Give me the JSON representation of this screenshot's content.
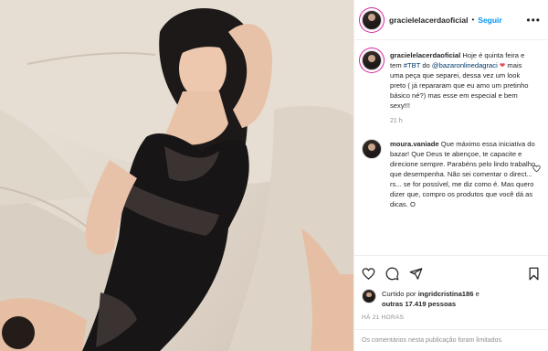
{
  "post": {
    "author": "gracielelacerdaoficial",
    "separator": "•",
    "follow_label": "Seguir",
    "more_icon": "more-horizontal-icon"
  },
  "caption": {
    "username": "gracielelacerdaoficial",
    "text_1": "Hoje é quinta feira e tem ",
    "hashtag": "#TBT",
    "text_2": " do ",
    "mention": "@bazaronlinedagraci",
    "heart": "❤",
    "text_3": " mais uma peça que separei, dessa vez um look preto ( já repararam que eu amo um pretinho básico né?) mas esse em especial e bem sexy!!!",
    "time": "21 h"
  },
  "comment": {
    "username": "moura.vaniade",
    "text": "Que máximo essa iniciativa do bazar! Que Deus te abençoe, te capacite e direcione sempre. Parabéns pelo lindo trabalho que desempenha. Não sei comentar o direct... rs... se for possível, me diz como é. Mas quero dizer que, compro os produtos que você dá as dicas. O"
  },
  "actions": {
    "like_icon": "heart-icon",
    "comment_icon": "comment-icon",
    "share_icon": "share-icon",
    "save_icon": "bookmark-icon"
  },
  "likes": {
    "prefix": "Curtido por ",
    "first_user": "ingridcristina186",
    "middle": " e",
    "others_prefix": "outras ",
    "others_count": "17.419",
    "others_suffix": " pessoas"
  },
  "date_label": "HÁ 21 HORAS",
  "comments_limited": "Os comentários nesta publicação foram limitados.",
  "colors": {
    "accent": "#0095f6",
    "link": "#00376b",
    "heart": "#ed4956",
    "muted": "#8e8e8e"
  }
}
